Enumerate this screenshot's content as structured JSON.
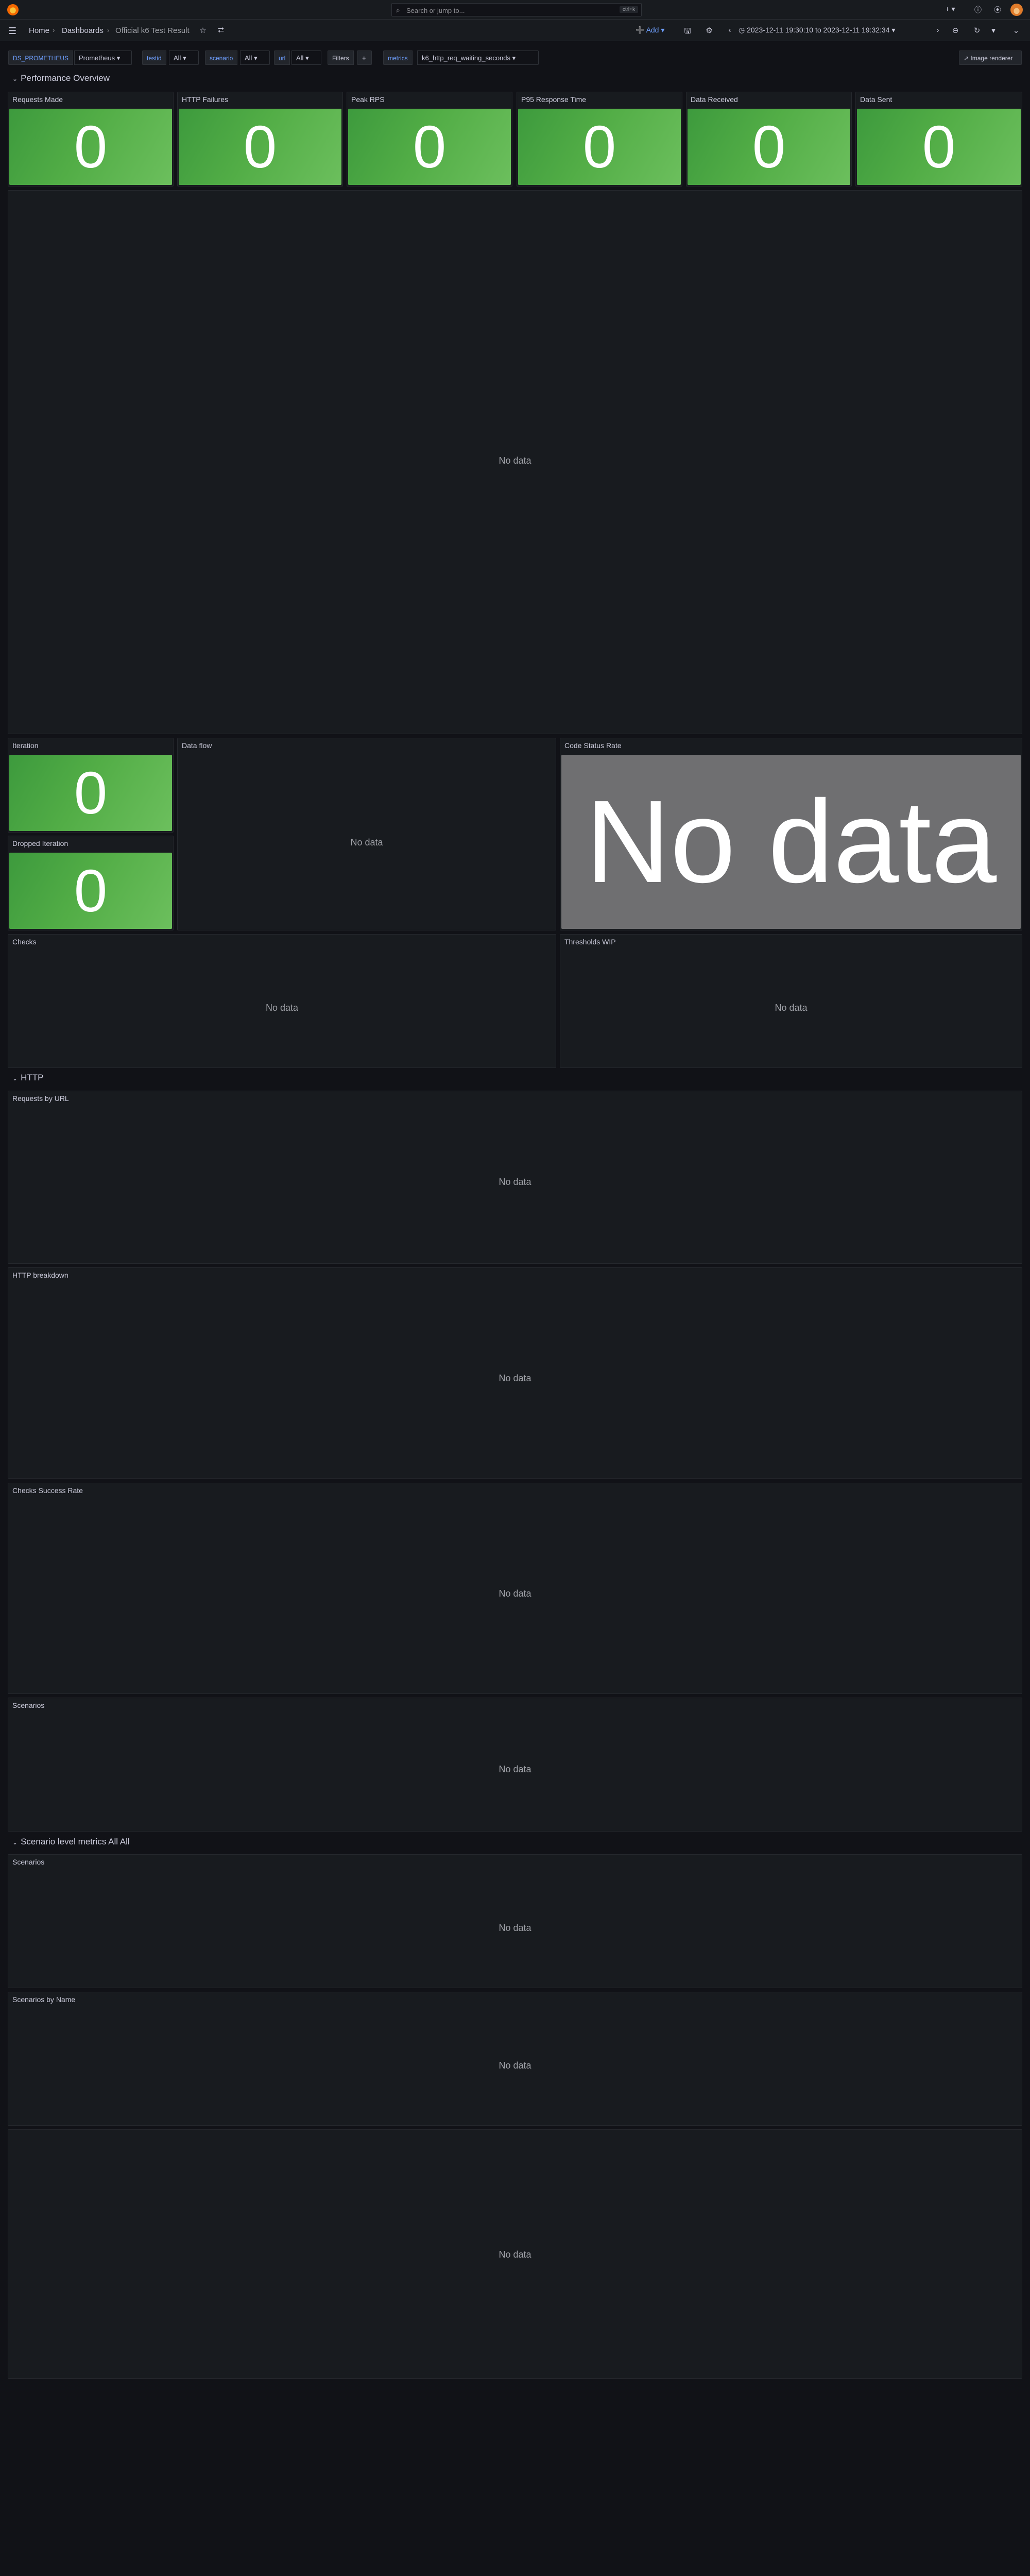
{
  "topbar": {
    "search_placeholder": "Search or jump to...",
    "search_shortcut": "ctrl+k",
    "plus_icon": "plus-icon",
    "help_icon": "help-icon",
    "news_icon": "rss-icon"
  },
  "nav": {
    "breadcrumbs": [
      "Home",
      "Dashboards",
      "Official k6 Test Result"
    ],
    "add_label": "Add",
    "time_range": "2023-12-11 19:30:10 to 2023-12-11 19:32:34"
  },
  "variables": [
    {
      "label": "DS_PROMETHEUS",
      "value": "Prometheus"
    },
    {
      "label": "testid",
      "value": "All"
    },
    {
      "label": "scenario",
      "value": "All"
    },
    {
      "label": "url",
      "value": "All"
    },
    {
      "label": "Filters",
      "value": "+"
    },
    {
      "label": "metrics",
      "value": "k6_http_req_waiting_seconds"
    }
  ],
  "image_renderer_label": "Image renderer",
  "rows": {
    "performance": "Performance Overview",
    "http": "HTTP",
    "scenario": "Scenario level metrics All All"
  },
  "stats": {
    "requests_made": {
      "title": "Requests Made",
      "value": "0"
    },
    "http_failures": {
      "title": "HTTP Failures",
      "value": "0"
    },
    "peak_rps": {
      "title": "Peak RPS",
      "value": "0"
    },
    "p95": {
      "title": "P95 Response Time",
      "value": "0"
    },
    "data_received": {
      "title": "Data Received",
      "value": "0"
    },
    "data_sent": {
      "title": "Data Sent",
      "value": "0"
    },
    "iteration": {
      "title": "Iteration",
      "value": "0"
    },
    "dropped_iteration": {
      "title": "Dropped Iteration",
      "value": "0"
    }
  },
  "panels": {
    "data_flow": "Data flow",
    "code_status_rate": "Code Status Rate",
    "checks": "Checks",
    "thresholds": "Thresholds WIP",
    "requests_by_url": "Requests by URL",
    "http_breakdown": "HTTP breakdown",
    "checks_success_rate": "Checks Success Rate",
    "scenarios": "Scenarios",
    "scenarios2": "Scenarios",
    "scenarios_by_name": "Scenarios by Name"
  },
  "no_data": "No data",
  "colors": {
    "stat_green": "#52ad46",
    "no_data_gray": "#6f6f71",
    "accent": "#6e9fff"
  }
}
